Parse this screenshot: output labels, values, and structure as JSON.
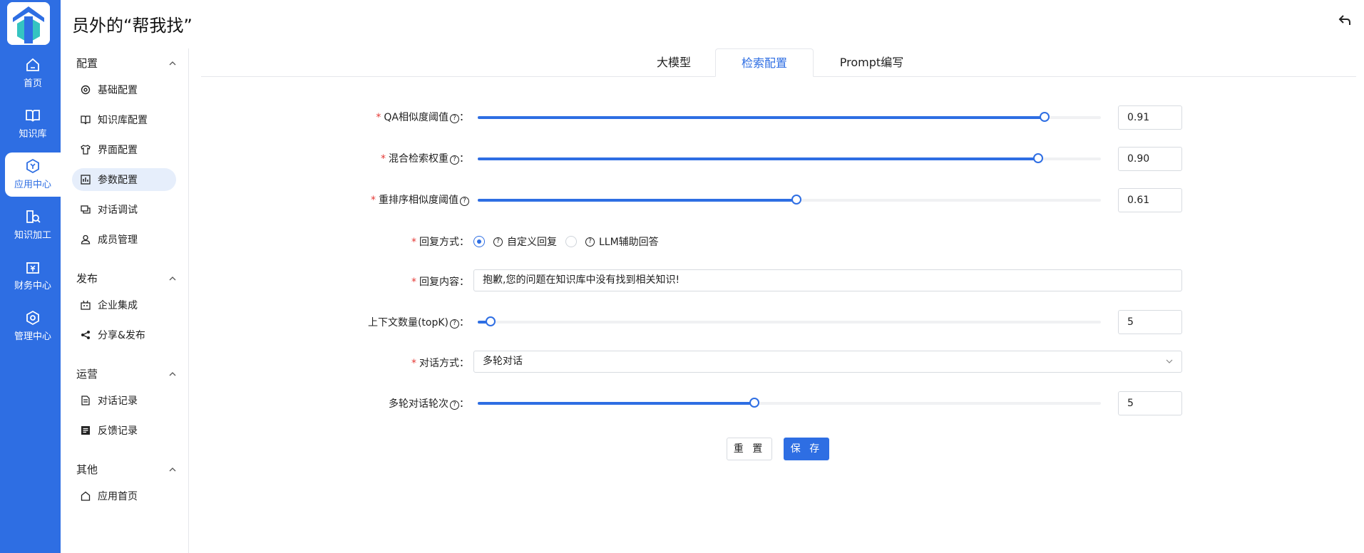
{
  "app": {
    "title": "员外的“帮我找”"
  },
  "rail": {
    "items": [
      {
        "label": "首页",
        "icon": "home-icon"
      },
      {
        "label": "知识库",
        "icon": "book-icon"
      },
      {
        "label": "应用中心",
        "icon": "app-center-icon"
      },
      {
        "label": "知识加工",
        "icon": "knowledge-process-icon"
      },
      {
        "label": "财务中心",
        "icon": "finance-icon"
      },
      {
        "label": "管理中心",
        "icon": "settings-icon"
      }
    ],
    "active_index": 2
  },
  "sidebar": {
    "groups": [
      {
        "title": "配置",
        "items": [
          "基础配置",
          "知识库配置",
          "界面配置",
          "参数配置",
          "对话调试",
          "成员管理"
        ]
      },
      {
        "title": "发布",
        "items": [
          "企业集成",
          "分享&发布"
        ]
      },
      {
        "title": "运营",
        "items": [
          "对话记录",
          "反馈记录"
        ]
      },
      {
        "title": "其他",
        "items": [
          "应用首页"
        ]
      }
    ],
    "active_item": "参数配置"
  },
  "tabs": [
    {
      "label": "大模型"
    },
    {
      "label": "检索配置"
    },
    {
      "label": "Prompt编写"
    }
  ],
  "active_tab": "检索配置",
  "form": {
    "qa_threshold": {
      "label": "QA相似度阈值",
      "value": "0.91",
      "fraction": 0.91
    },
    "hybrid_weight": {
      "label": "混合检索权重",
      "value": "0.90",
      "fraction": 0.9
    },
    "rerank_threshold": {
      "label": "重排序相似度阈值",
      "value": "0.61",
      "fraction": 0.61
    },
    "reply_mode": {
      "label": "回复方式",
      "options": [
        "自定义回复",
        "LLM辅助回答"
      ],
      "selected": "自定义回复"
    },
    "reply_content": {
      "label": "回复内容",
      "value": "抱歉,您的问题在知识库中没有找到相关知识!"
    },
    "topk": {
      "label": "上下文数量(topK)",
      "value": "5"
    },
    "dialog_mode": {
      "label": "对话方式",
      "value": "多轮对话"
    },
    "dialog_rounds": {
      "label": "多轮对话轮次",
      "value": "5"
    },
    "colon": "："
  },
  "buttons": {
    "reset": "重 置",
    "save": "保 存"
  },
  "colors": {
    "primary": "#2e6ee3",
    "required": "#e53935"
  }
}
